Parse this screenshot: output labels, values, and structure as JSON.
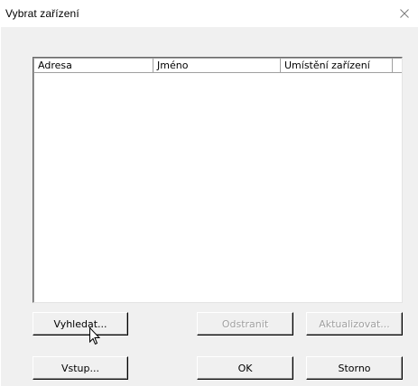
{
  "window": {
    "title": "Vybrat zařízení",
    "close_icon": "close-icon"
  },
  "list": {
    "columns": [
      "Adresa",
      "Jméno",
      "Umístění zařízení"
    ],
    "rows": []
  },
  "buttons": {
    "search": {
      "label": "Vyhledat...",
      "enabled": true
    },
    "remove": {
      "label": "Odstranit",
      "enabled": false
    },
    "update": {
      "label": "Aktualizovat...",
      "enabled": false
    },
    "input": {
      "label": "Vstup...",
      "enabled": true
    },
    "ok": {
      "label": "OK",
      "enabled": true
    },
    "cancel": {
      "label": "Storno",
      "enabled": true
    }
  },
  "colors": {
    "dialog_bg": "#f0f0f0",
    "titlebar_bg": "#ffffff",
    "disabled_text": "#a0a0a0"
  }
}
